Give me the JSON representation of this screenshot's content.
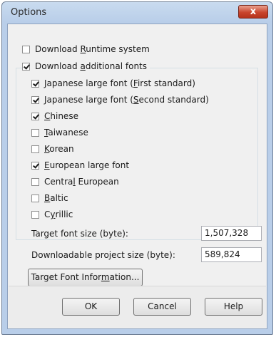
{
  "window": {
    "title": "Options",
    "close_glyph": "x"
  },
  "options": {
    "download_runtime": {
      "pre": "Download ",
      "accel": "R",
      "post": "untime system",
      "checked": false
    },
    "download_fonts": {
      "pre": "Download ",
      "accel": "a",
      "post": "dditional fonts",
      "checked": true
    }
  },
  "fonts": [
    {
      "pre": "Japanese large font (",
      "accel": "F",
      "post": "irst standard)",
      "checked": true
    },
    {
      "pre": "Japanese large font (",
      "accel": "S",
      "post": "econd standard)",
      "checked": true
    },
    {
      "pre": "",
      "accel": "C",
      "post": "hinese",
      "checked": true
    },
    {
      "pre": "",
      "accel": "T",
      "post": "aiwanese",
      "checked": false
    },
    {
      "pre": "",
      "accel": "K",
      "post": "orean",
      "checked": false
    },
    {
      "pre": "",
      "accel": "E",
      "post": "uropean large font",
      "checked": true
    },
    {
      "pre": "Centra",
      "accel": "l",
      "post": " European",
      "checked": false
    },
    {
      "pre": "",
      "accel": "B",
      "post": "altic",
      "checked": false
    },
    {
      "pre": "C",
      "accel": "y",
      "post": "rillic",
      "checked": false
    }
  ],
  "sizes": {
    "target_label": "Target font size (byte):",
    "target_value": "1,507,328",
    "project_label": "Downloadable project size (byte):",
    "project_value": "589,824"
  },
  "buttons": {
    "info": {
      "pre": "Target Font Infor",
      "accel": "m",
      "post": "ation..."
    },
    "ok": "OK",
    "cancel": "Cancel",
    "help": "Help"
  }
}
